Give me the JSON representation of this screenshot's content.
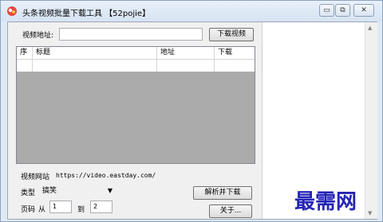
{
  "window": {
    "title": "头条视频批量下载工具 【52pojie】",
    "min_glyph": "▭",
    "max_glyph": "⧉",
    "close_glyph": "✕"
  },
  "form": {
    "video_url_label": "视频地址:",
    "video_url_value": "",
    "download_video_button": "下载视频"
  },
  "table": {
    "columns": [
      "序",
      "标题",
      "地址",
      "下载"
    ]
  },
  "info": {
    "site_label": "视频网站",
    "site_url": "https://video.eastday.com/"
  },
  "type_select": {
    "label": "类型",
    "selected": "搞笑"
  },
  "parse_button": "解析并下载",
  "pages": {
    "label": "页码",
    "from_label": "从",
    "from_value": "1",
    "to_label": "到",
    "to_value": "2"
  },
  "about_button": "关于...",
  "watermark": "最需网",
  "colors": {
    "accent": "#2323b8",
    "table_bg": "#ababab",
    "window_bg": "#dfe9f5"
  },
  "icons": {
    "app": "app-logo-icon",
    "scroll_up": "▲",
    "scroll_down": "▼",
    "dropdown": "▼"
  }
}
